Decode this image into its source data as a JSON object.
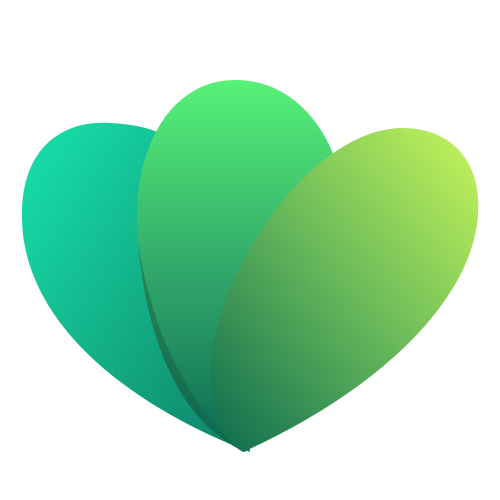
{
  "logo": {
    "name": "three-petal-leaf-logo",
    "colors": {
      "left_petal_top": "#17e3ad",
      "left_petal_bottom": "#0f7f64",
      "middle_petal_top": "#57f277",
      "middle_petal_bottom": "#0b6a52",
      "right_petal_top": "#c8f65a",
      "right_petal_bottom": "#0b6a4f",
      "background": "#ffffff"
    }
  }
}
